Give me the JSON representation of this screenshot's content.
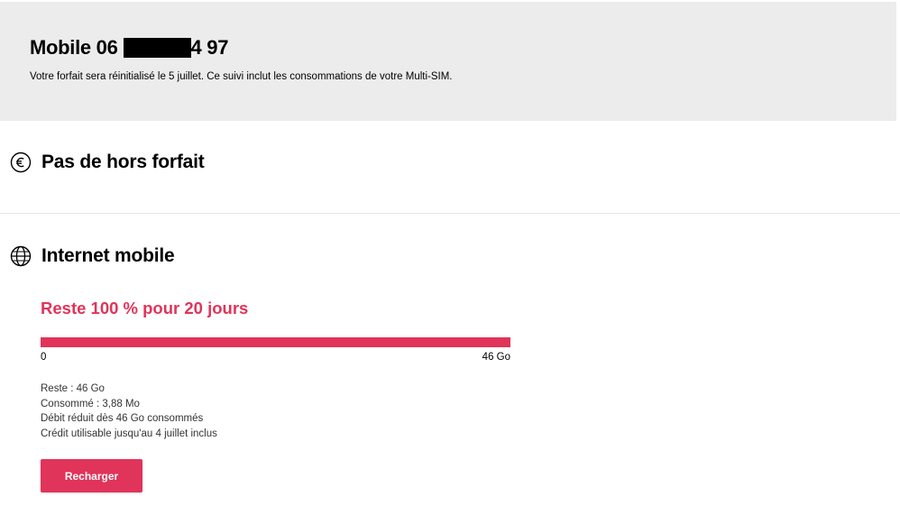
{
  "header": {
    "title_prefix": "Mobile 06",
    "title_suffix": "4 97",
    "subtitle": "Votre forfait sera réinitialisé le 5 juillet. Ce suivi inclut les consommations de votre Multi-SIM."
  },
  "sections": {
    "billing": {
      "icon": "euro-icon",
      "title": "Pas de hors forfait"
    },
    "internet": {
      "icon": "globe-icon",
      "title": "Internet mobile",
      "remaining_text": "Reste 100 % pour 20 jours",
      "progress_percent": 100,
      "bar_min_label": "0",
      "bar_max_label": "46 Go",
      "details": {
        "remaining": "Reste : 46 Go",
        "consumed": "Consommé : 3,88 Mo",
        "reduced_speed": "Débit réduit dès 46 Go consommés",
        "credit": "Crédit utilisable jusqu'au 4 juillet inclus"
      },
      "button_label": "Recharger"
    }
  },
  "colors": {
    "accent": "#e0345a",
    "header_bg": "#ececec"
  }
}
